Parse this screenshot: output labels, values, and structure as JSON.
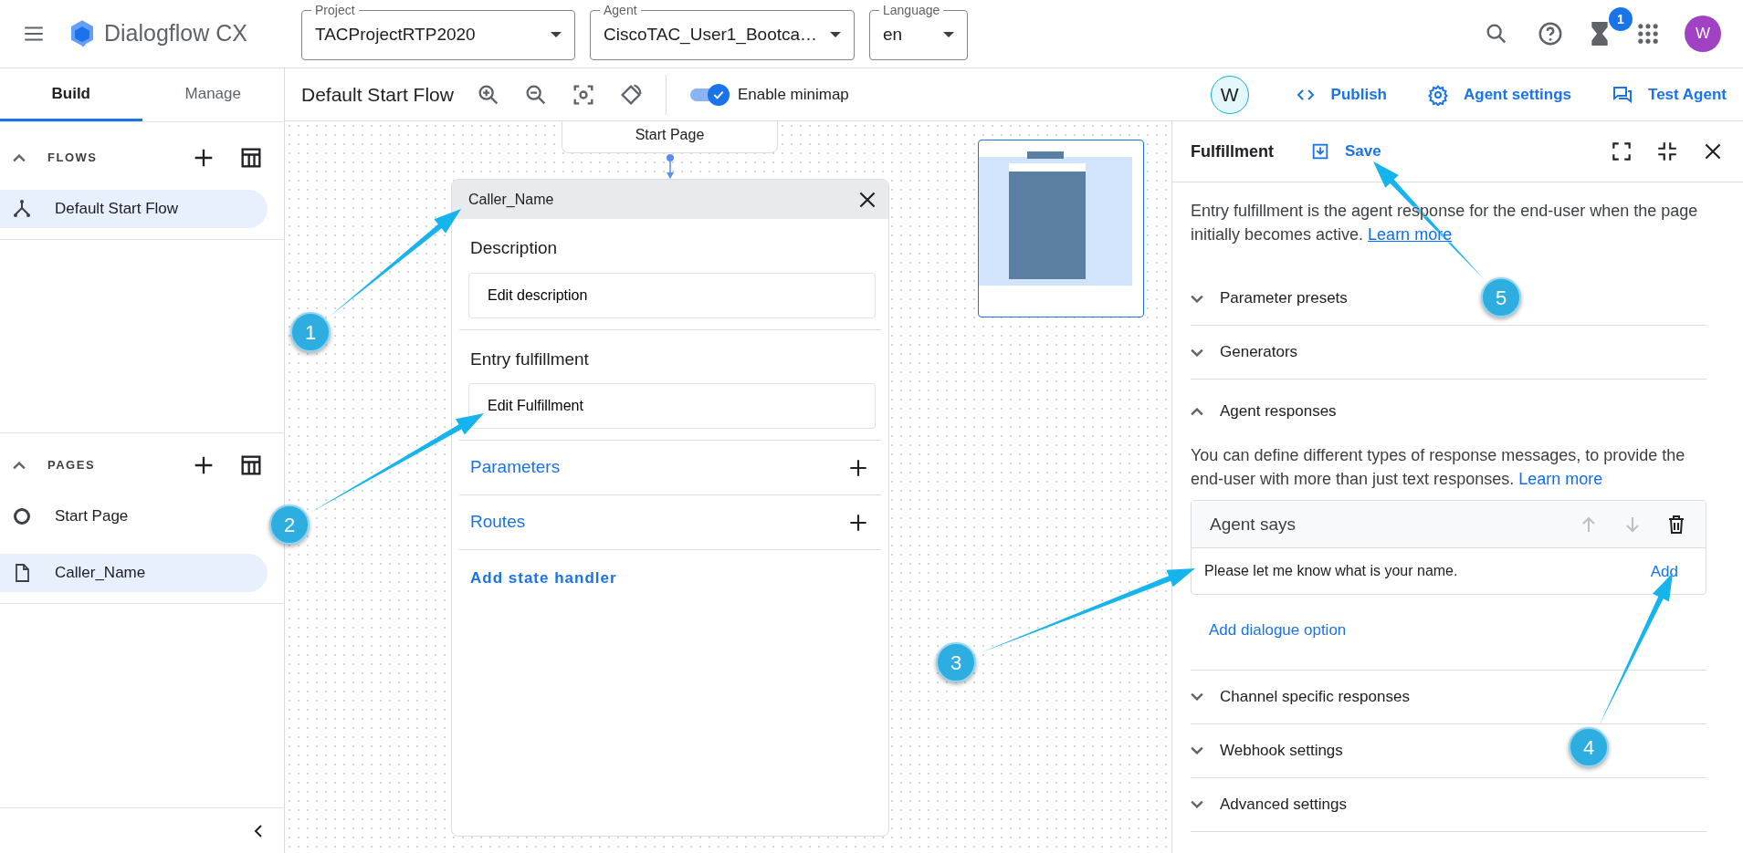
{
  "app_bar": {
    "title": "Dialogflow CX",
    "selectors": [
      {
        "label": "Project",
        "value": "TACProjectRTP2020"
      },
      {
        "label": "Agent",
        "value": "CiscoTAC_User1_Bootca…"
      },
      {
        "label": "Language",
        "value": "en"
      }
    ],
    "notification_count": "1",
    "avatar": "W"
  },
  "sidebar": {
    "tabs": [
      {
        "label": "Build",
        "selected": true
      },
      {
        "label": "Manage",
        "selected": false
      }
    ],
    "sections": [
      {
        "title": "FLOWS",
        "expanded": true,
        "items": [
          {
            "label": "Default Start Flow",
            "kind": "flow",
            "selected": true
          }
        ]
      },
      {
        "title": "PAGES",
        "expanded": true,
        "items": [
          {
            "label": "Start Page",
            "kind": "start",
            "selected": false
          },
          {
            "label": "Caller_Name",
            "kind": "page",
            "selected": true
          }
        ]
      }
    ]
  },
  "toolbar": {
    "flow_title": "Default Start Flow",
    "minimap": {
      "label": "Enable minimap",
      "on": true
    },
    "collaborator": "W",
    "actions": [
      {
        "label": "Publish",
        "kind": "code"
      },
      {
        "label": "Agent settings",
        "kind": "gear"
      },
      {
        "label": "Test Agent",
        "kind": "chat"
      }
    ]
  },
  "canvas": {
    "start_node": "Start Page",
    "page_node": {
      "title": "Caller_Name",
      "description_label": "Description",
      "description_button": "Edit description",
      "fulfillment_label": "Entry fulfillment",
      "fulfillment_button": "Edit Fulfillment",
      "links": [
        "Parameters",
        "Routes"
      ],
      "add_handler": "Add state handler"
    }
  },
  "fulfillment_panel": {
    "title": "Fulfillment",
    "save": "Save",
    "intro": "Entry fulfillment is the agent response for the end-user when the page initially becomes active.",
    "intro_link": "Learn more",
    "sections": [
      {
        "title": "Parameter presets",
        "expanded": false
      },
      {
        "title": "Generators",
        "expanded": false
      },
      {
        "title": "Agent responses",
        "expanded": true,
        "description": "You can define different types of response messages, to provide the end-user with more than just text responses.",
        "link": "Learn more",
        "card": {
          "title": "Agent says",
          "message": "Please let me know what is your name.",
          "add": "Add"
        },
        "add_option": "Add dialogue option"
      },
      {
        "title": "Channel specific responses",
        "expanded": false
      },
      {
        "title": "Webhook settings",
        "expanded": false
      },
      {
        "title": "Advanced settings",
        "expanded": false
      }
    ]
  },
  "annotations": [
    {
      "number": "1"
    },
    {
      "number": "2"
    },
    {
      "number": "3"
    },
    {
      "number": "4"
    },
    {
      "number": "5"
    }
  ]
}
